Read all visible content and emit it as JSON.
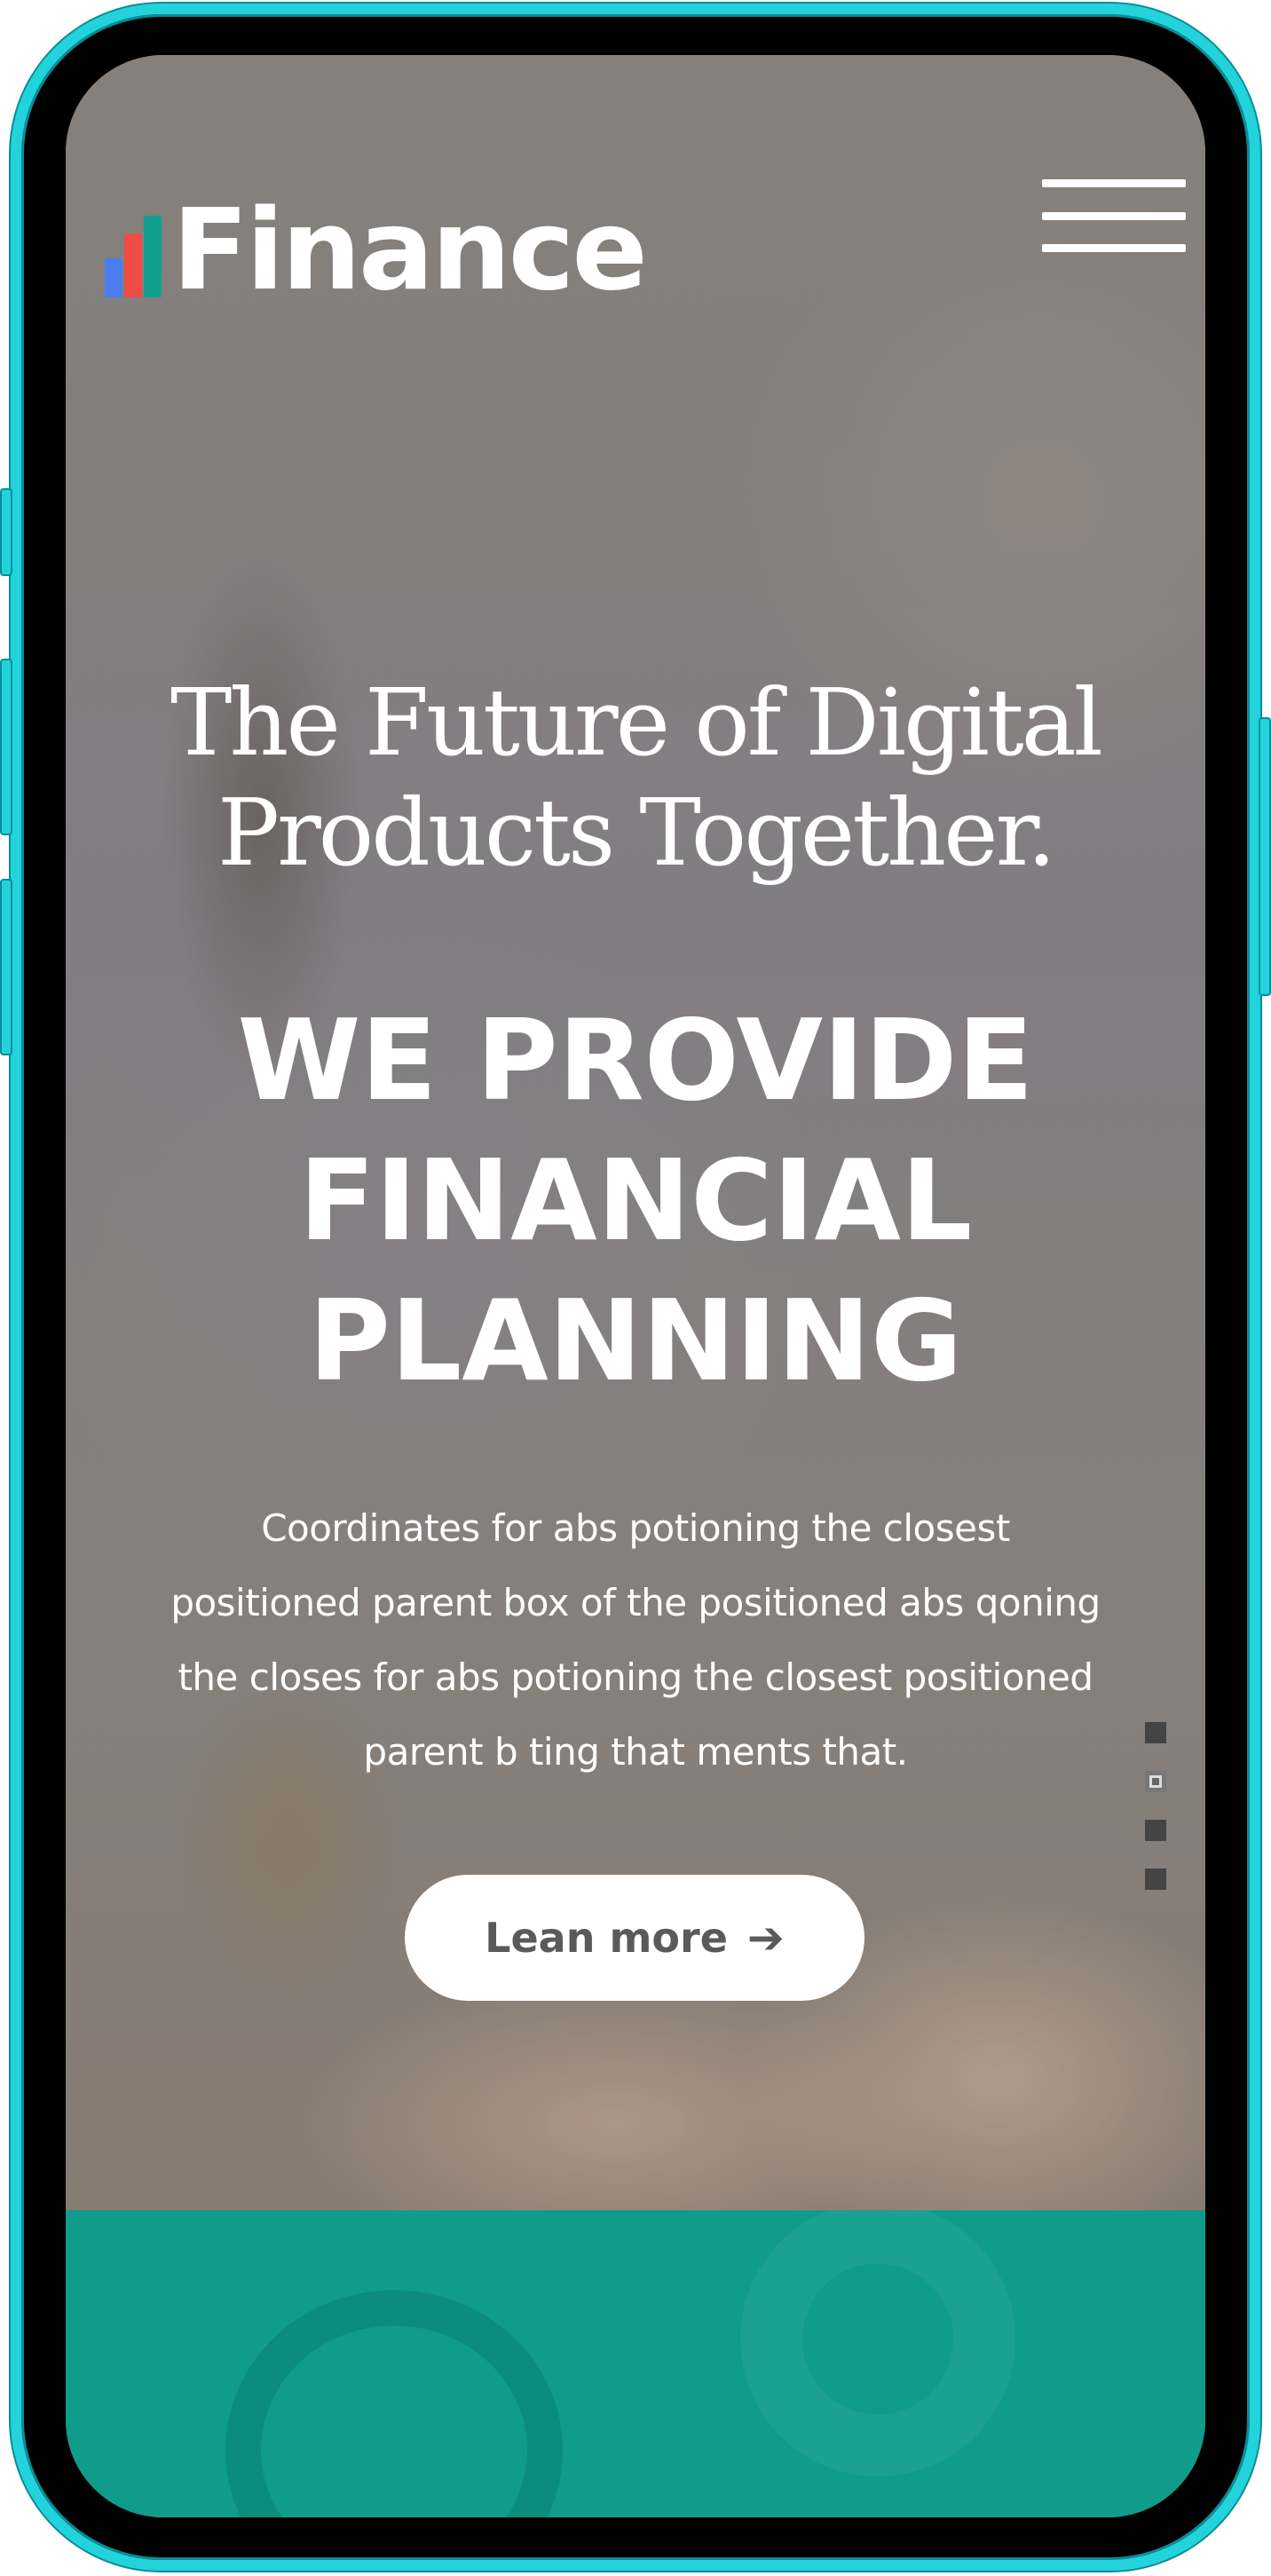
{
  "header": {
    "logo_text": "Finance",
    "logo_bar_colors": [
      "#4a7df0",
      "#ef4c45",
      "#12a08e"
    ]
  },
  "hero": {
    "tagline_line1": "The Future of Digital",
    "tagline_line2": "Products Together.",
    "headline_line1": "WE PROVIDE",
    "headline_line2": "FINANCIAL",
    "headline_line3": "PLANNING",
    "description_lines": [
      "Coordinates for abs potioning the closest",
      "positioned parent box of the positioned abs qoning",
      "the closes for abs potioning the closest positioned",
      "parent b ting that ments that."
    ],
    "cta_label": "Lean more",
    "cta_icon": "arrow-right-icon"
  },
  "slider": {
    "total": 4,
    "active_index": 1
  },
  "colors": {
    "frame": "#23d3dc",
    "teal_section": "#0f9c8a",
    "text": "#ffffff",
    "button_text": "#5a5a5a"
  }
}
